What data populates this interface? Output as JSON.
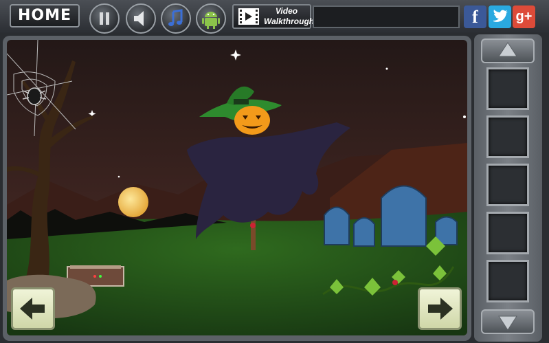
{
  "toolbar": {
    "home_label": "HOME",
    "video_line1": "Video",
    "video_line2": "Walkthrough"
  },
  "social": {
    "facebook": "f",
    "twitter": "t",
    "googleplus": "g+"
  },
  "colors": {
    "sky": "#2a1c1c",
    "grass": "#1f4a17",
    "moon": "#f1c65e",
    "pumpkin": "#f39a1a",
    "hat": "#2e8b2e",
    "cloak": "#2a2440",
    "tombstone": "#3e73a8"
  },
  "inventory": {
    "slot_count": 5
  }
}
